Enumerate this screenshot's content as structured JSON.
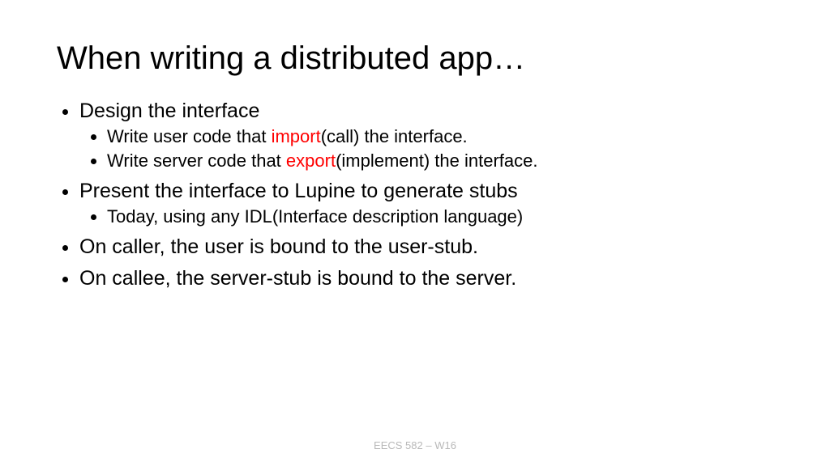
{
  "slide": {
    "title": "When writing a distributed app…",
    "bullets": [
      {
        "text": "Design the interface",
        "sub": [
          {
            "pre": "Write user code that ",
            "hl": "import",
            "post": "(call) the interface."
          },
          {
            "pre": "Write server code that ",
            "hl": "export",
            "post": "(implement) the interface."
          }
        ]
      },
      {
        "text": "Present the interface to Lupine to generate stubs",
        "sub": [
          {
            "pre": "Today, using any IDL(Interface description language)",
            "hl": "",
            "post": ""
          }
        ]
      },
      {
        "text": "On caller, the user is bound to the user-stub."
      },
      {
        "text": "On callee, the server-stub is bound to the server."
      }
    ],
    "footer": "EECS 582 – W16"
  }
}
